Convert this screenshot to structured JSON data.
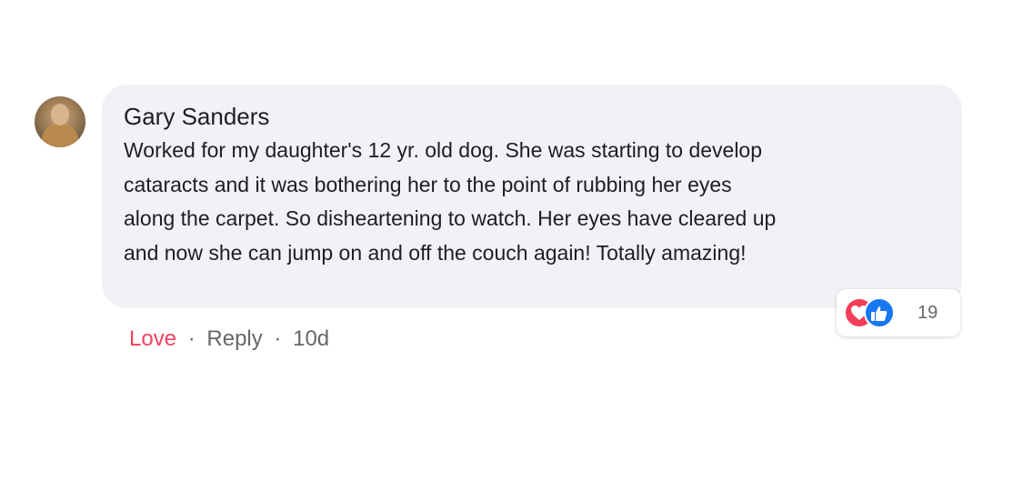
{
  "comment": {
    "author": "Gary Sanders",
    "lines": [
      "Worked for my daughter's 12 yr. old dog. She was starting to develop",
      "cataracts and it was bothering her to the point of rubbing her eyes",
      "along the carpet. So disheartening to watch. Her eyes have cleared up",
      "and now she can jump on and off the couch again! Totally amazing!"
    ]
  },
  "reactions": {
    "icons": [
      "love-icon",
      "like-icon"
    ],
    "count": "19"
  },
  "actions": {
    "love_label": "Love",
    "separator": "·",
    "reply_label": "Reply",
    "timestamp": "10d"
  },
  "colors": {
    "bubble": "#f0f2f5",
    "love": "#f33e58",
    "like": "#1877f2",
    "meta": "#65676b",
    "text": "#1c1e21"
  }
}
